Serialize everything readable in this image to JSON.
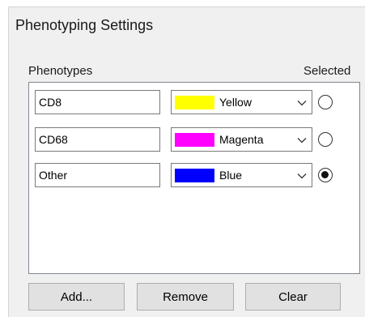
{
  "window": {
    "title": "Phenotyping Settings"
  },
  "header": {
    "phenotypes_label": "Phenotypes",
    "selected_label": "Selected"
  },
  "rows": [
    {
      "name": "CD8",
      "color_name": "Yellow",
      "color_hex": "#ffff00",
      "selected": false
    },
    {
      "name": "CD68",
      "color_name": "Magenta",
      "color_hex": "#ff00ff",
      "selected": false
    },
    {
      "name": "Other",
      "color_name": "Blue",
      "color_hex": "#0000ff",
      "selected": true
    }
  ],
  "buttons": {
    "add": "Add...",
    "remove": "Remove",
    "clear": "Clear"
  }
}
